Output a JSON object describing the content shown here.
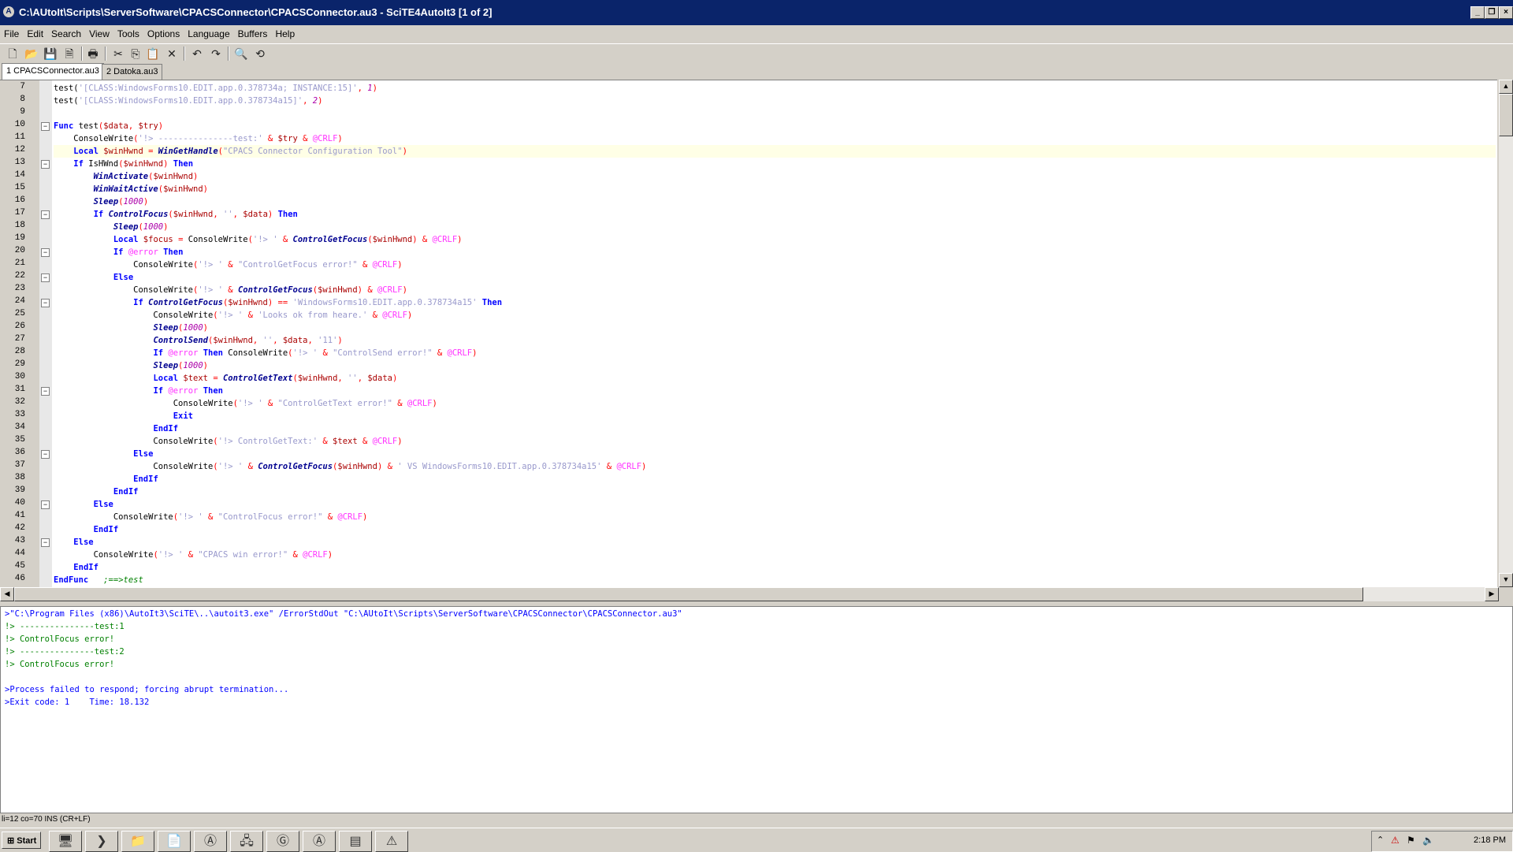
{
  "window": {
    "title": "C:\\AUtoIt\\Scripts\\ServerSoftware\\CPACSConnector\\CPACSConnector.au3 - SciTE4AutoIt3 [1 of 2]"
  },
  "menu": [
    "File",
    "Edit",
    "Search",
    "View",
    "Tools",
    "Options",
    "Language",
    "Buffers",
    "Help"
  ],
  "toolbar": [
    "new-icon",
    "open-icon",
    "save-icon",
    "close-file-icon",
    "print-icon",
    "cut-icon",
    "copy-icon",
    "paste-icon",
    "delete-icon",
    "undo-icon",
    "redo-icon",
    "find-icon",
    "replace-icon"
  ],
  "tabs": [
    {
      "label": "1 CPACSConnector.au3",
      "active": true
    },
    {
      "label": "2 Datoka.au3",
      "active": false
    }
  ],
  "editor": {
    "current_line": 12,
    "lines": [
      {
        "n": "7",
        "h": "test(<span class=str>'[CLASS:WindowsForms10.EDIT.app.0.378734a; INSTANCE:15]'</span><span class=op>,</span> <span class=num>1</span><span class=op>)</span>"
      },
      {
        "n": "8",
        "h": "test(<span class=str>'[CLASS:WindowsForms10.EDIT.app.0.378734a15]'</span><span class=op>,</span> <span class=num>2</span><span class=op>)</span>"
      },
      {
        "n": "9",
        "h": ""
      },
      {
        "n": "10",
        "f": "-",
        "h": "<span class=kw>Func</span> test<span class=op>(</span><span class=var>$data</span><span class=op>,</span> <span class=var>$try</span><span class=op>)</span>"
      },
      {
        "n": "11",
        "h": "    ConsoleWrite<span class=op>(</span><span class=str>'!&gt; ---------------test:'</span> <span class=op>&amp;</span> <span class=var>$try</span> <span class=op>&amp;</span> <span class=mac>@CRLF</span><span class=op>)</span>"
      },
      {
        "n": "12",
        "h": "    <span class=kw>Local</span> <span class=var>$winHwnd</span> <span class=op>=</span> <span class=fn>WinGetHandle</span><span class=op>(</span><span class=str>\"CPACS Connector Configuration Tool\"</span><span class=op>)</span>"
      },
      {
        "n": "13",
        "f": "-",
        "h": "    <span class=kw>If</span> IsHWnd<span class=op>(</span><span class=var>$winHwnd</span><span class=op>)</span> <span class=kw>Then</span>"
      },
      {
        "n": "14",
        "h": "        <span class=fn>WinActivate</span><span class=op>(</span><span class=var>$winHwnd</span><span class=op>)</span>"
      },
      {
        "n": "15",
        "h": "        <span class=fn>WinWaitActive</span><span class=op>(</span><span class=var>$winHwnd</span><span class=op>)</span>"
      },
      {
        "n": "16",
        "h": "        <span class=fn>Sleep</span><span class=op>(</span><span class=num>1000</span><span class=op>)</span>"
      },
      {
        "n": "17",
        "f": "-",
        "h": "        <span class=kw>If</span> <span class=fn>ControlFocus</span><span class=op>(</span><span class=var>$winHwnd</span><span class=op>,</span> <span class=str>''</span><span class=op>,</span> <span class=var>$data</span><span class=op>)</span> <span class=kw>Then</span>"
      },
      {
        "n": "18",
        "h": "            <span class=fn>Sleep</span><span class=op>(</span><span class=num>1000</span><span class=op>)</span>"
      },
      {
        "n": "19",
        "h": "            <span class=kw>Local</span> <span class=var>$focus</span> <span class=op>=</span> ConsoleWrite<span class=op>(</span><span class=str>'!&gt; '</span> <span class=op>&amp;</span> <span class=fn>ControlGetFocus</span><span class=op>(</span><span class=var>$winHwnd</span><span class=op>)</span> <span class=op>&amp;</span> <span class=mac>@CRLF</span><span class=op>)</span>"
      },
      {
        "n": "20",
        "f": "-",
        "h": "            <span class=kw>If</span> <span class=mac>@error</span> <span class=kw>Then</span>"
      },
      {
        "n": "21",
        "h": "                ConsoleWrite<span class=op>(</span><span class=str>'!&gt; '</span> <span class=op>&amp;</span> <span class=str>\"ControlGetFocus error!\"</span> <span class=op>&amp;</span> <span class=mac>@CRLF</span><span class=op>)</span>"
      },
      {
        "n": "22",
        "f": "-",
        "h": "            <span class=kw>Else</span>"
      },
      {
        "n": "23",
        "h": "                ConsoleWrite<span class=op>(</span><span class=str>'!&gt; '</span> <span class=op>&amp;</span> <span class=fn>ControlGetFocus</span><span class=op>(</span><span class=var>$winHwnd</span><span class=op>)</span> <span class=op>&amp;</span> <span class=mac>@CRLF</span><span class=op>)</span>"
      },
      {
        "n": "24",
        "f": "-",
        "h": "                <span class=kw>If</span> <span class=fn>ControlGetFocus</span><span class=op>(</span><span class=var>$winHwnd</span><span class=op>)</span> <span class=op>==</span> <span class=str>'WindowsForms10.EDIT.app.0.378734a15'</span> <span class=kw>Then</span>"
      },
      {
        "n": "25",
        "h": "                    ConsoleWrite<span class=op>(</span><span class=str>'!&gt; '</span> <span class=op>&amp;</span> <span class=str>'Looks ok from heare.'</span> <span class=op>&amp;</span> <span class=mac>@CRLF</span><span class=op>)</span>"
      },
      {
        "n": "26",
        "h": "                    <span class=fn>Sleep</span><span class=op>(</span><span class=num>1000</span><span class=op>)</span>"
      },
      {
        "n": "27",
        "h": "                    <span class=fn>ControlSend</span><span class=op>(</span><span class=var>$winHwnd</span><span class=op>,</span> <span class=str>''</span><span class=op>,</span> <span class=var>$data</span><span class=op>,</span> <span class=str>'11'</span><span class=op>)</span>"
      },
      {
        "n": "28",
        "h": "                    <span class=kw>If</span> <span class=mac>@error</span> <span class=kw>Then</span> ConsoleWrite<span class=op>(</span><span class=str>'!&gt; '</span> <span class=op>&amp;</span> <span class=str>\"ControlSend error!\"</span> <span class=op>&amp;</span> <span class=mac>@CRLF</span><span class=op>)</span>"
      },
      {
        "n": "29",
        "h": "                    <span class=fn>Sleep</span><span class=op>(</span><span class=num>1000</span><span class=op>)</span>"
      },
      {
        "n": "30",
        "h": "                    <span class=kw>Local</span> <span class=var>$text</span> <span class=op>=</span> <span class=fn>ControlGetText</span><span class=op>(</span><span class=var>$winHwnd</span><span class=op>,</span> <span class=str>''</span><span class=op>,</span> <span class=var>$data</span><span class=op>)</span>"
      },
      {
        "n": "31",
        "f": "-",
        "h": "                    <span class=kw>If</span> <span class=mac>@error</span> <span class=kw>Then</span>"
      },
      {
        "n": "32",
        "h": "                        ConsoleWrite<span class=op>(</span><span class=str>'!&gt; '</span> <span class=op>&amp;</span> <span class=str>\"ControlGetText error!\"</span> <span class=op>&amp;</span> <span class=mac>@CRLF</span><span class=op>)</span>"
      },
      {
        "n": "33",
        "h": "                        <span class=kw>Exit</span>"
      },
      {
        "n": "34",
        "h": "                    <span class=kw>EndIf</span>"
      },
      {
        "n": "35",
        "h": "                    ConsoleWrite<span class=op>(</span><span class=str>'!&gt; ControlGetText:'</span> <span class=op>&amp;</span> <span class=var>$text</span> <span class=op>&amp;</span> <span class=mac>@CRLF</span><span class=op>)</span>"
      },
      {
        "n": "36",
        "f": "-",
        "h": "                <span class=kw>Else</span>"
      },
      {
        "n": "37",
        "h": "                    ConsoleWrite<span class=op>(</span><span class=str>'!&gt; '</span> <span class=op>&amp;</span> <span class=fn>ControlGetFocus</span><span class=op>(</span><span class=var>$winHwnd</span><span class=op>)</span> <span class=op>&amp;</span> <span class=str>' VS WindowsForms10.EDIT.app.0.378734a15'</span> <span class=op>&amp;</span> <span class=mac>@CRLF</span><span class=op>)</span>"
      },
      {
        "n": "38",
        "h": "                <span class=kw>EndIf</span>"
      },
      {
        "n": "39",
        "h": "            <span class=kw>EndIf</span>"
      },
      {
        "n": "40",
        "f": "-",
        "h": "        <span class=kw>Else</span>"
      },
      {
        "n": "41",
        "h": "            ConsoleWrite<span class=op>(</span><span class=str>'!&gt; '</span> <span class=op>&amp;</span> <span class=str>\"ControlFocus error!\"</span> <span class=op>&amp;</span> <span class=mac>@CRLF</span><span class=op>)</span>"
      },
      {
        "n": "42",
        "h": "        <span class=kw>EndIf</span>"
      },
      {
        "n": "43",
        "f": "-",
        "h": "    <span class=kw>Else</span>"
      },
      {
        "n": "44",
        "h": "        ConsoleWrite<span class=op>(</span><span class=str>'!&gt; '</span> <span class=op>&amp;</span> <span class=str>\"CPACS win error!\"</span> <span class=op>&amp;</span> <span class=mac>@CRLF</span><span class=op>)</span>"
      },
      {
        "n": "45",
        "h": "    <span class=kw>EndIf</span>"
      },
      {
        "n": "46",
        "h": "<span class=kw>EndFunc</span>   <span class=cmt>;==&gt;test</span>"
      }
    ]
  },
  "output": [
    {
      "text": ">\"C:\\Program Files (x86)\\AutoIt3\\SciTE\\..\\autoit3.exe\" /ErrorStdOut \"C:\\AUtoIt\\Scripts\\ServerSoftware\\CPACSConnector\\CPACSConnector.au3\"",
      "color": "blue"
    },
    {
      "text": "!> ---------------test:1",
      "color": "green"
    },
    {
      "text": "!> ControlFocus error!",
      "color": "green"
    },
    {
      "text": "!> ---------------test:2",
      "color": "green"
    },
    {
      "text": "!> ControlFocus error!",
      "color": "green"
    },
    {
      "text": "",
      "color": "blue"
    },
    {
      "text": ">Process failed to respond; forcing abrupt termination...",
      "color": "blue"
    },
    {
      "text": ">Exit code: 1    Time: 18.132",
      "color": "blue"
    }
  ],
  "status": "li=12 co=70 INS (CR+LF)",
  "taskbar": {
    "start_label": "Start",
    "items": [
      "server-manager-icon",
      "powershell-icon",
      "explorer-icon",
      "notepad-icon",
      "autoit-icon",
      "network-icon",
      "ge-icon",
      "autoit-icon",
      "cmd-icon",
      "warning-icon"
    ],
    "clock": "2:18 PM"
  }
}
